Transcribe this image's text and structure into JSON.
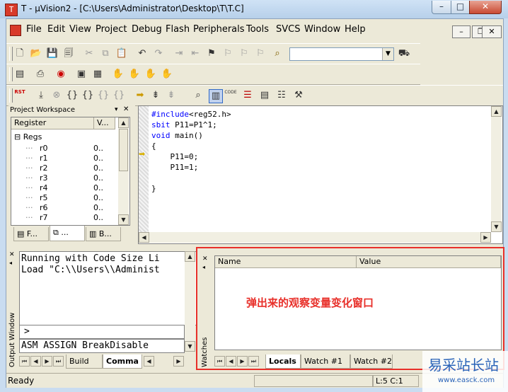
{
  "window": {
    "title": "T  - μVision2 - [C:\\Users\\Administrator\\Desktop\\T\\T.C]",
    "app_icon_text": "T",
    "minimize": "–",
    "maximize": "□",
    "close": "✕"
  },
  "menu": {
    "items": [
      "File",
      "Edit",
      "View",
      "Project",
      "Debug",
      "Flash",
      "Peripherals",
      "Tools",
      "SVCS",
      "Window",
      "Help"
    ],
    "mdi_min": "–",
    "mdi_restore": "❐",
    "mdi_close": "✕"
  },
  "toolbar": {
    "find_value": "",
    "rst_label": "RST",
    "code_label": "CODE"
  },
  "workspace": {
    "title": "Project Workspace",
    "col_register": "Register",
    "col_value": "V...",
    "group": "Regs",
    "registers": [
      {
        "name": "r0",
        "value": "0.."
      },
      {
        "name": "r1",
        "value": "0.."
      },
      {
        "name": "r2",
        "value": "0.."
      },
      {
        "name": "r3",
        "value": "0.."
      },
      {
        "name": "r4",
        "value": "0.."
      },
      {
        "name": "r5",
        "value": "0.."
      },
      {
        "name": "r6",
        "value": "0.."
      },
      {
        "name": "r7",
        "value": "0.."
      }
    ],
    "tabs": [
      "F...",
      "...",
      "B..."
    ]
  },
  "editor": {
    "lines": [
      "#include<reg52.h>",
      "sbit P11=P1^1;",
      "void main()",
      "{",
      "    P11=0;",
      "    P11=1;",
      "",
      "}"
    ]
  },
  "output": {
    "title": "Output Window",
    "lines": [
      "Running with Code Size Li",
      "Load \"C:\\\\Users\\\\Administ"
    ],
    "prompt": ">",
    "command_line": "ASM ASSIGN BreakDisable",
    "tabs": [
      "Build",
      "Comma"
    ]
  },
  "watches": {
    "title": "Watches",
    "col_name": "Name",
    "col_value": "Value",
    "annotation": "弹出来的观察变量变化窗口",
    "annotation_color": "#e8302a",
    "tabs": [
      "Locals",
      "Watch #1",
      "Watch #2"
    ]
  },
  "status": {
    "ready": "Ready",
    "position": "L:5 C:1"
  },
  "watermark": {
    "text": "易采站长站",
    "url": "www.easck.com"
  }
}
